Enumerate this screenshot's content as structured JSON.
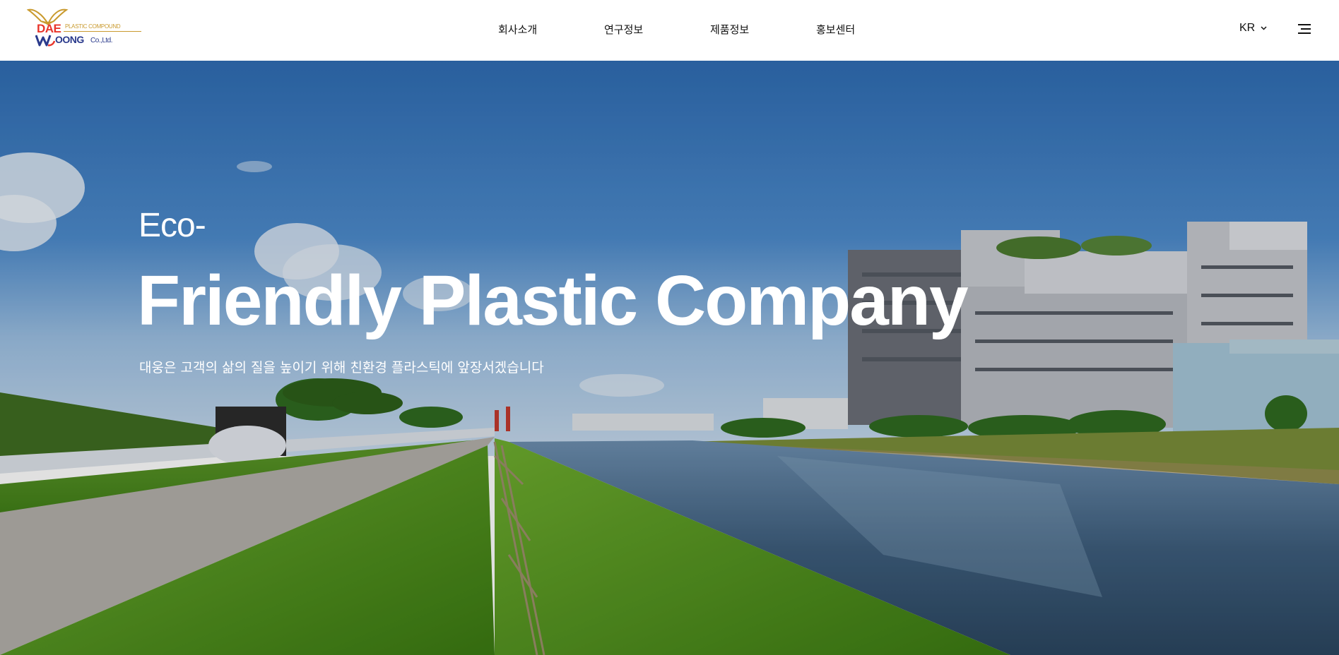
{
  "header": {
    "logo": {
      "word1": "DAE",
      "tagline": "PLASTIC COMPOUND",
      "word2": "OONG",
      "suffix": "Co.,Ltd."
    },
    "nav": [
      {
        "label": "회사소개"
      },
      {
        "label": "연구정보"
      },
      {
        "label": "제품정보"
      },
      {
        "label": "홍보센터"
      }
    ],
    "language": "KR",
    "menu_icon": "hamburger-icon"
  },
  "hero": {
    "eyebrow": "Eco-",
    "headline": "Friendly Plastic Company",
    "subtitle": "대웅은 고객의 삶의 질을 높이기 위해 친환경 플라스틱에 앞장서겠습니다"
  },
  "colors": {
    "brand_red": "#e8352b",
    "brand_gold": "#c99a2e",
    "brand_navy": "#2a3a8c",
    "hero_text": "#ffffff"
  }
}
